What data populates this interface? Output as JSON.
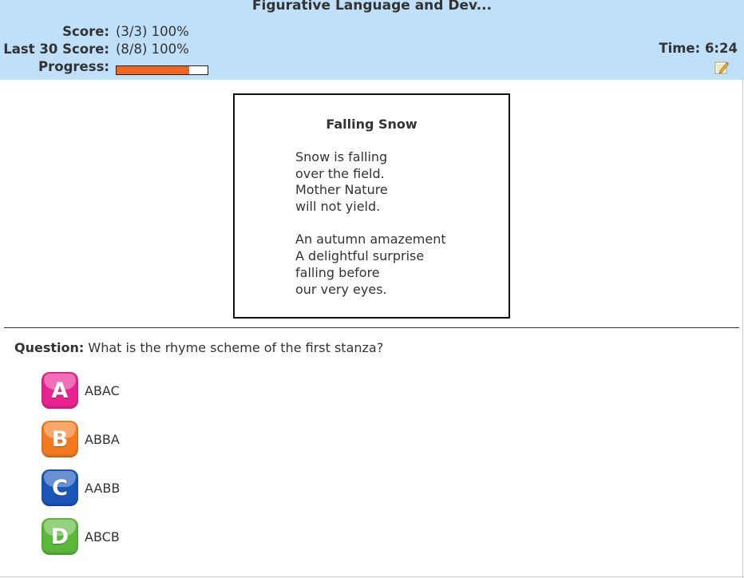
{
  "header": {
    "title": "Figurative Language and Dev...",
    "score_label": "Score:",
    "score_value": "(3/3) 100%",
    "last30_label": "Last 30 Score:",
    "last30_value": "(8/8) 100%",
    "progress_label": "Progress:",
    "progress_fraction": 0.8,
    "time_label": "Time: 6:24",
    "notepad_icon": "notepad-pencil-icon",
    "background_color": "#bfe0f8",
    "progress_color": "#f26422"
  },
  "poem": {
    "title": "Falling Snow",
    "lines": [
      "Snow is falling",
      "over the field.",
      "Mother Nature",
      "will not yield.",
      "",
      "An autumn amazement",
      "A delightful surprise",
      "falling before",
      "our very eyes."
    ]
  },
  "question": {
    "label": "Question:",
    "text": "What is the rhyme scheme of the first stanza?"
  },
  "choices": [
    {
      "letter": "A",
      "text": "ABAC",
      "color": "#e8238f"
    },
    {
      "letter": "B",
      "text": "ABBA",
      "color": "#f47a20"
    },
    {
      "letter": "C",
      "text": "AABB",
      "color": "#1a56b8"
    },
    {
      "letter": "D",
      "text": "ABCB",
      "color": "#5cb83a"
    }
  ]
}
